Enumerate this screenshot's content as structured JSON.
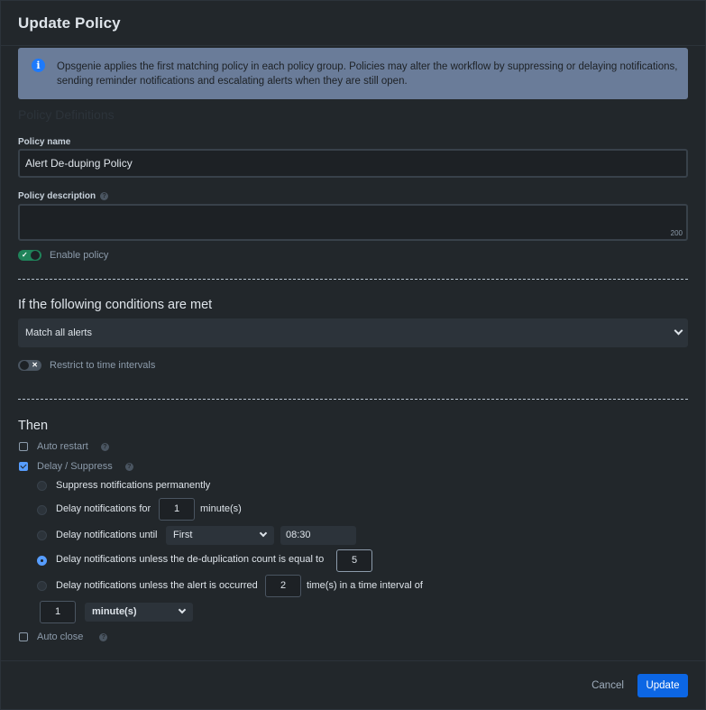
{
  "modal": {
    "title": "Update Policy"
  },
  "info": {
    "icon": "info-icon",
    "text": "Opsgenie applies the first matching policy in each policy group. Policies may alter the workflow by suppressing or delaying notifications, sending reminder notifications and escalating alerts when they are still open."
  },
  "definitions": {
    "section_title": "Policy Definitions",
    "name_label": "Policy name",
    "name_value": "Alert De-duping Policy",
    "description_label": "Policy description",
    "description_value": "",
    "description_counter": "200",
    "enable_label": "Enable policy",
    "enable_on": true
  },
  "conditions": {
    "title": "If the following conditions are met",
    "match_value": "Match all alerts",
    "restrict_label": "Restrict to time intervals",
    "restrict_on": false
  },
  "then": {
    "title": "Then",
    "auto_restart_label": "Auto restart",
    "auto_restart_checked": false,
    "delay_suppress_label": "Delay / Suppress",
    "delay_suppress_checked": true,
    "options": {
      "suppress": "Suppress notifications permanently",
      "delay_for": "Delay notifications for",
      "delay_for_value": "1",
      "delay_for_unit": "minute(s)",
      "delay_until": "Delay notifications until",
      "delay_until_day": "First",
      "delay_until_time": "08:30",
      "dedup": "Delay notifications unless the de-duplication count is equal to",
      "dedup_value": "5",
      "occurred": "Delay notifications unless the alert is occurred",
      "occurred_value": "2",
      "occurred_suffix": "time(s) in a time interval of",
      "interval_value": "1",
      "interval_unit": "minute(s)",
      "selected": "dedup"
    },
    "auto_close_label": "Auto close",
    "auto_close_checked": false
  },
  "footer": {
    "cancel_label": "Cancel",
    "update_label": "Update"
  },
  "colors": {
    "accent": "#0c66e4",
    "toggle_on": "#1f845a",
    "info_bg": "#6a7c99",
    "check": "#579dff"
  }
}
